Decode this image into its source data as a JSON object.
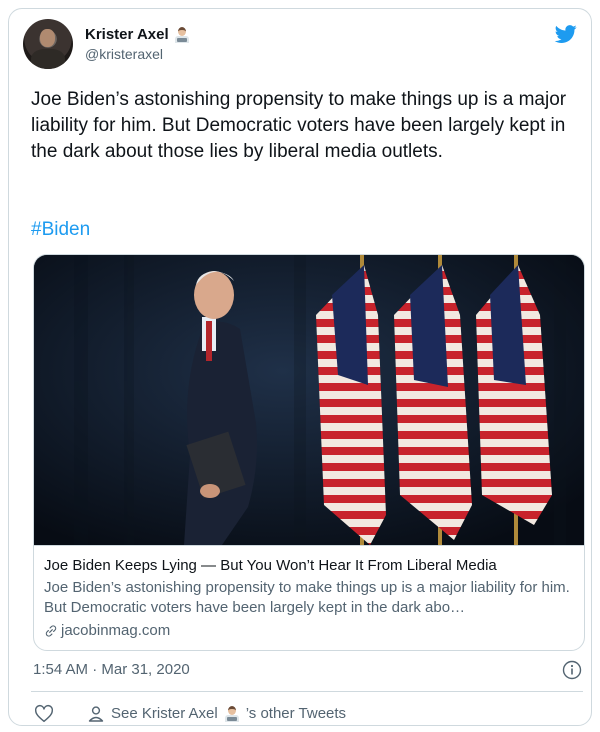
{
  "author": {
    "display_name": "Krister Axel",
    "handle": "@kristeraxel",
    "badge_icon": "technologist-emoji",
    "avatar_icon": "profile-photo"
  },
  "logo_icon": "twitter-bird-icon",
  "accent_color": "#1d9bf0",
  "tweet": {
    "text": "Joe Biden’s astonishing propensity to make things up is a major liability for him. But Democratic voters have been largely kept in the dark about those lies by liberal media outlets.",
    "hashtag": "#Biden"
  },
  "link_card": {
    "image_icon": "photo-biden-walking-past-flags",
    "title": "Joe Biden Keeps Lying — But You Won’t Hear It From Liberal Media",
    "description": "Joe Biden’s astonishing propensity to make things up is a major liability for him. But Democratic voters have been largely kept in the dark abo…",
    "domain": "jacobinmag.com",
    "domain_icon": "link-icon"
  },
  "timestamp": "1:54 AM · Mar 31, 2020",
  "footer": {
    "like_icon": "heart-icon",
    "see_prefix": "See Krister Axel",
    "see_suffix": "’s other Tweets",
    "person_icon": "person-icon"
  }
}
